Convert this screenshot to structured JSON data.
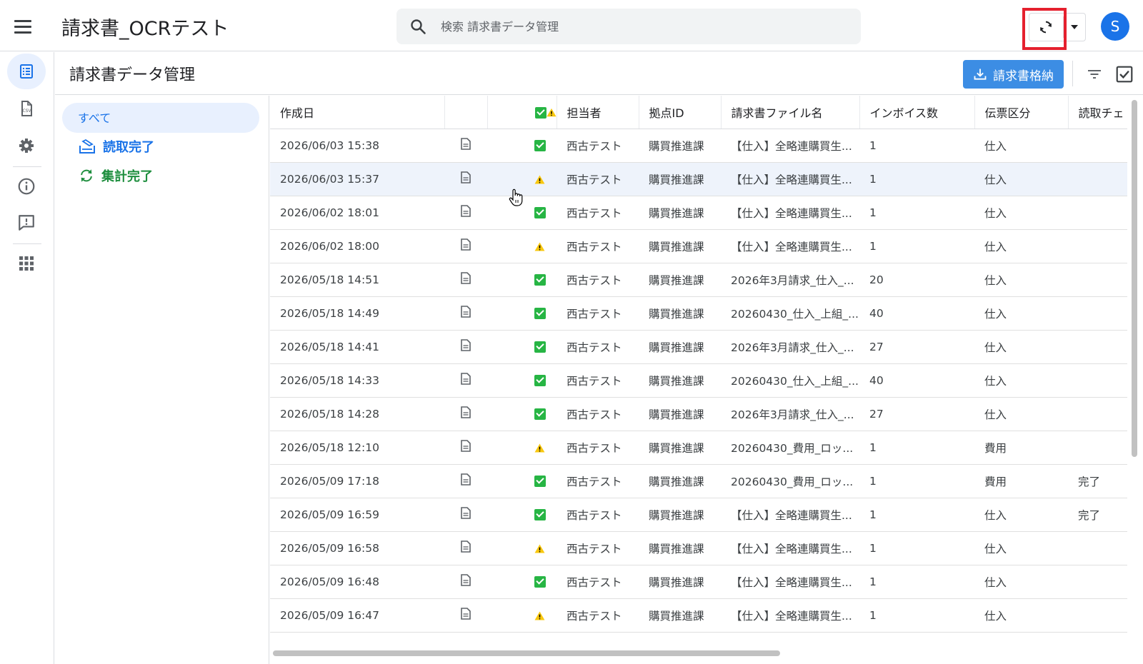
{
  "app": {
    "title": "請求書_OCRテスト",
    "avatar_letter": "S"
  },
  "search": {
    "placeholder": "検索 請求書データ管理"
  },
  "page": {
    "title": "請求書データ管理",
    "store_button": "請求書格納"
  },
  "categories": {
    "all": "すべて",
    "read_done": "読取完了",
    "aggregate_done": "集計完了"
  },
  "table": {
    "headers": {
      "date": "作成日",
      "person": "担当者",
      "base": "拠点ID",
      "file": "請求書ファイル名",
      "invoice_count": "インボイス数",
      "slip": "伝票区分",
      "read_check": "読取チェ"
    },
    "rows": [
      {
        "date": "2026/06/03 15:38",
        "status": "ok",
        "person": "西古テスト",
        "base": "購買推進課",
        "file": "【仕入】全略連購買生...",
        "count": "1",
        "slip": "仕入",
        "read": ""
      },
      {
        "date": "2026/06/03 15:37",
        "status": "warn",
        "person": "西古テスト",
        "base": "購買推進課",
        "file": "【仕入】全略連購買生...",
        "count": "1",
        "slip": "仕入",
        "read": ""
      },
      {
        "date": "2026/06/02 18:01",
        "status": "ok",
        "person": "西古テスト",
        "base": "購買推進課",
        "file": "【仕入】全略連購買生...",
        "count": "1",
        "slip": "仕入",
        "read": ""
      },
      {
        "date": "2026/06/02 18:00",
        "status": "warn",
        "person": "西古テスト",
        "base": "購買推進課",
        "file": "【仕入】全略連購買生...",
        "count": "1",
        "slip": "仕入",
        "read": ""
      },
      {
        "date": "2026/05/18 14:51",
        "status": "ok",
        "person": "西古テスト",
        "base": "購買推進課",
        "file": "2026年3月請求_仕入_...",
        "count": "20",
        "slip": "仕入",
        "read": ""
      },
      {
        "date": "2026/05/18 14:49",
        "status": "ok",
        "person": "西古テスト",
        "base": "購買推進課",
        "file": "20260430_仕入_上組_...",
        "count": "40",
        "slip": "仕入",
        "read": ""
      },
      {
        "date": "2026/05/18 14:41",
        "status": "ok",
        "person": "西古テスト",
        "base": "購買推進課",
        "file": "2026年3月請求_仕入_...",
        "count": "27",
        "slip": "仕入",
        "read": ""
      },
      {
        "date": "2026/05/18 14:33",
        "status": "ok",
        "person": "西古テスト",
        "base": "購買推進課",
        "file": "20260430_仕入_上組_...",
        "count": "40",
        "slip": "仕入",
        "read": ""
      },
      {
        "date": "2026/05/18 14:28",
        "status": "ok",
        "person": "西古テスト",
        "base": "購買推進課",
        "file": "2026年3月請求_仕入_...",
        "count": "27",
        "slip": "仕入",
        "read": ""
      },
      {
        "date": "2026/05/18 12:10",
        "status": "warn",
        "person": "西古テスト",
        "base": "購買推進課",
        "file": "20260430_費用_ロッ...",
        "count": "1",
        "slip": "費用",
        "read": ""
      },
      {
        "date": "2026/05/09 17:18",
        "status": "ok",
        "person": "西古テスト",
        "base": "購買推進課",
        "file": "20260430_費用_ロッ...",
        "count": "1",
        "slip": "費用",
        "read": "完了"
      },
      {
        "date": "2026/05/09 16:59",
        "status": "ok",
        "person": "西古テスト",
        "base": "購買推進課",
        "file": "【仕入】全略連購買生...",
        "count": "1",
        "slip": "仕入",
        "read": "完了"
      },
      {
        "date": "2026/05/09 16:58",
        "status": "warn",
        "person": "西古テスト",
        "base": "購買推進課",
        "file": "【仕入】全略連購買生...",
        "count": "1",
        "slip": "仕入",
        "read": ""
      },
      {
        "date": "2026/05/09 16:48",
        "status": "ok",
        "person": "西古テスト",
        "base": "購買推進課",
        "file": "【仕入】全略連購買生...",
        "count": "1",
        "slip": "仕入",
        "read": ""
      },
      {
        "date": "2026/05/09 16:47",
        "status": "warn",
        "person": "西古テスト",
        "base": "購買推進課",
        "file": "【仕入】全略連購買生...",
        "count": "1",
        "slip": "仕入",
        "read": ""
      }
    ]
  },
  "colors": {
    "accent": "#1a73e8",
    "ok": "#27b544",
    "warn": "#f9c80e",
    "highlight": "#e5202e"
  },
  "icons": {
    "menu": "menu-icon",
    "search": "search-icon",
    "sync": "sync-icon",
    "dropdown": "caret-down-icon",
    "rail": [
      "invoice-list-icon",
      "csv-file-icon",
      "gear-icon",
      "info-icon",
      "feedback-icon",
      "apps-grid-icon"
    ],
    "row_doc": "document-icon",
    "ok": "check-square-icon",
    "warn": "warning-icon",
    "filter": "filter-icon",
    "select": "checkbox-icon",
    "store": "download-tray-icon",
    "read_done": "read-tray-icon",
    "aggregate_done": "refresh-icon"
  }
}
